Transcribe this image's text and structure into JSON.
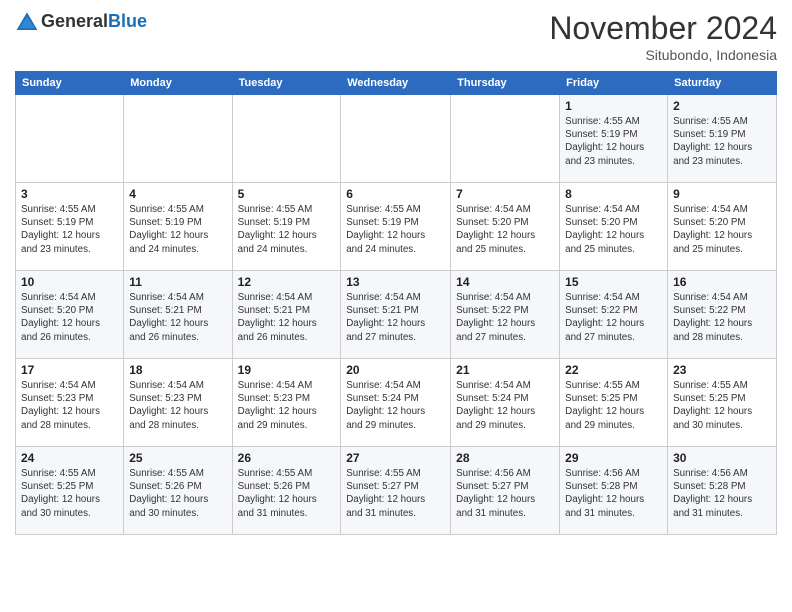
{
  "header": {
    "logo_line1": "General",
    "logo_line2": "Blue",
    "month": "November 2024",
    "location": "Situbondo, Indonesia"
  },
  "weekdays": [
    "Sunday",
    "Monday",
    "Tuesday",
    "Wednesday",
    "Thursday",
    "Friday",
    "Saturday"
  ],
  "weeks": [
    [
      {
        "day": "",
        "info": ""
      },
      {
        "day": "",
        "info": ""
      },
      {
        "day": "",
        "info": ""
      },
      {
        "day": "",
        "info": ""
      },
      {
        "day": "",
        "info": ""
      },
      {
        "day": "1",
        "info": "Sunrise: 4:55 AM\nSunset: 5:19 PM\nDaylight: 12 hours\nand 23 minutes."
      },
      {
        "day": "2",
        "info": "Sunrise: 4:55 AM\nSunset: 5:19 PM\nDaylight: 12 hours\nand 23 minutes."
      }
    ],
    [
      {
        "day": "3",
        "info": "Sunrise: 4:55 AM\nSunset: 5:19 PM\nDaylight: 12 hours\nand 23 minutes."
      },
      {
        "day": "4",
        "info": "Sunrise: 4:55 AM\nSunset: 5:19 PM\nDaylight: 12 hours\nand 24 minutes."
      },
      {
        "day": "5",
        "info": "Sunrise: 4:55 AM\nSunset: 5:19 PM\nDaylight: 12 hours\nand 24 minutes."
      },
      {
        "day": "6",
        "info": "Sunrise: 4:55 AM\nSunset: 5:19 PM\nDaylight: 12 hours\nand 24 minutes."
      },
      {
        "day": "7",
        "info": "Sunrise: 4:54 AM\nSunset: 5:20 PM\nDaylight: 12 hours\nand 25 minutes."
      },
      {
        "day": "8",
        "info": "Sunrise: 4:54 AM\nSunset: 5:20 PM\nDaylight: 12 hours\nand 25 minutes."
      },
      {
        "day": "9",
        "info": "Sunrise: 4:54 AM\nSunset: 5:20 PM\nDaylight: 12 hours\nand 25 minutes."
      }
    ],
    [
      {
        "day": "10",
        "info": "Sunrise: 4:54 AM\nSunset: 5:20 PM\nDaylight: 12 hours\nand 26 minutes."
      },
      {
        "day": "11",
        "info": "Sunrise: 4:54 AM\nSunset: 5:21 PM\nDaylight: 12 hours\nand 26 minutes."
      },
      {
        "day": "12",
        "info": "Sunrise: 4:54 AM\nSunset: 5:21 PM\nDaylight: 12 hours\nand 26 minutes."
      },
      {
        "day": "13",
        "info": "Sunrise: 4:54 AM\nSunset: 5:21 PM\nDaylight: 12 hours\nand 27 minutes."
      },
      {
        "day": "14",
        "info": "Sunrise: 4:54 AM\nSunset: 5:22 PM\nDaylight: 12 hours\nand 27 minutes."
      },
      {
        "day": "15",
        "info": "Sunrise: 4:54 AM\nSunset: 5:22 PM\nDaylight: 12 hours\nand 27 minutes."
      },
      {
        "day": "16",
        "info": "Sunrise: 4:54 AM\nSunset: 5:22 PM\nDaylight: 12 hours\nand 28 minutes."
      }
    ],
    [
      {
        "day": "17",
        "info": "Sunrise: 4:54 AM\nSunset: 5:23 PM\nDaylight: 12 hours\nand 28 minutes."
      },
      {
        "day": "18",
        "info": "Sunrise: 4:54 AM\nSunset: 5:23 PM\nDaylight: 12 hours\nand 28 minutes."
      },
      {
        "day": "19",
        "info": "Sunrise: 4:54 AM\nSunset: 5:23 PM\nDaylight: 12 hours\nand 29 minutes."
      },
      {
        "day": "20",
        "info": "Sunrise: 4:54 AM\nSunset: 5:24 PM\nDaylight: 12 hours\nand 29 minutes."
      },
      {
        "day": "21",
        "info": "Sunrise: 4:54 AM\nSunset: 5:24 PM\nDaylight: 12 hours\nand 29 minutes."
      },
      {
        "day": "22",
        "info": "Sunrise: 4:55 AM\nSunset: 5:25 PM\nDaylight: 12 hours\nand 29 minutes."
      },
      {
        "day": "23",
        "info": "Sunrise: 4:55 AM\nSunset: 5:25 PM\nDaylight: 12 hours\nand 30 minutes."
      }
    ],
    [
      {
        "day": "24",
        "info": "Sunrise: 4:55 AM\nSunset: 5:25 PM\nDaylight: 12 hours\nand 30 minutes."
      },
      {
        "day": "25",
        "info": "Sunrise: 4:55 AM\nSunset: 5:26 PM\nDaylight: 12 hours\nand 30 minutes."
      },
      {
        "day": "26",
        "info": "Sunrise: 4:55 AM\nSunset: 5:26 PM\nDaylight: 12 hours\nand 31 minutes."
      },
      {
        "day": "27",
        "info": "Sunrise: 4:55 AM\nSunset: 5:27 PM\nDaylight: 12 hours\nand 31 minutes."
      },
      {
        "day": "28",
        "info": "Sunrise: 4:56 AM\nSunset: 5:27 PM\nDaylight: 12 hours\nand 31 minutes."
      },
      {
        "day": "29",
        "info": "Sunrise: 4:56 AM\nSunset: 5:28 PM\nDaylight: 12 hours\nand 31 minutes."
      },
      {
        "day": "30",
        "info": "Sunrise: 4:56 AM\nSunset: 5:28 PM\nDaylight: 12 hours\nand 31 minutes."
      }
    ]
  ]
}
